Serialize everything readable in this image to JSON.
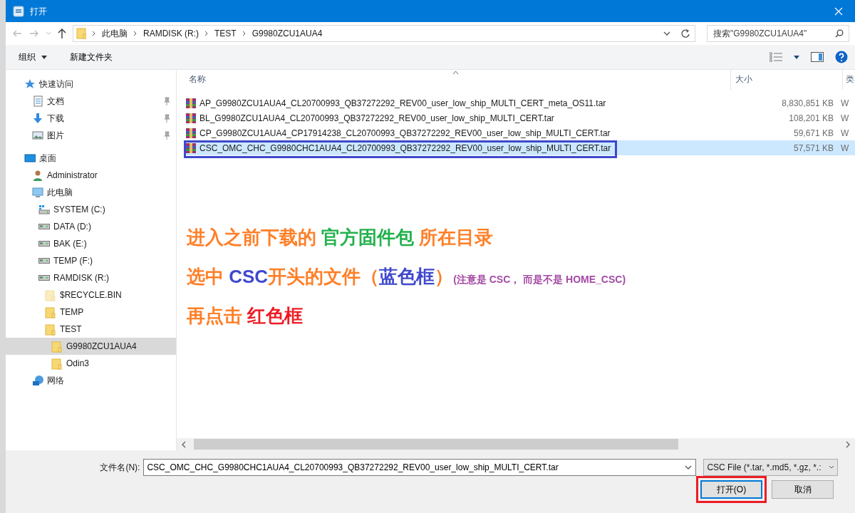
{
  "window": {
    "title": "打开"
  },
  "breadcrumb": [
    "此电脑",
    "RAMDISK (R:)",
    "TEST",
    "G9980ZCU1AUA4"
  ],
  "search": {
    "placeholder": "搜索\"G9980ZCU1AUA4\""
  },
  "toolbar": {
    "organize": "组织",
    "new_folder": "新建文件夹"
  },
  "sidebar": {
    "items": [
      {
        "label": "快速访问",
        "kind": "star",
        "selected": false,
        "children": [
          {
            "label": "文档",
            "kind": "document",
            "pinned": true,
            "selected": false
          },
          {
            "label": "下载",
            "kind": "download",
            "pinned": true,
            "selected": false
          },
          {
            "label": "图片",
            "kind": "picture",
            "pinned": true,
            "selected": false
          }
        ]
      },
      {
        "label": "桌面",
        "kind": "desktop",
        "selected": false,
        "children": [
          {
            "label": "Administrator",
            "kind": "user",
            "selected": false
          },
          {
            "label": "此电脑",
            "kind": "computer",
            "selected": false,
            "children": [
              {
                "label": "SYSTEM (C:)",
                "kind": "system-drive",
                "selected": false
              },
              {
                "label": "DATA (D:)",
                "kind": "drive",
                "selected": false
              },
              {
                "label": "BAK (E:)",
                "kind": "drive",
                "selected": false
              },
              {
                "label": "TEMP (F:)",
                "kind": "drive",
                "selected": false
              },
              {
                "label": "RAMDISK (R:)",
                "kind": "drive",
                "selected": false,
                "children": [
                  {
                    "label": "$RECYCLE.BIN",
                    "kind": "folder",
                    "hidden": true,
                    "selected": false
                  },
                  {
                    "label": "TEMP",
                    "kind": "folder",
                    "selected": false
                  },
                  {
                    "label": "TEST",
                    "kind": "folder",
                    "selected": false,
                    "children": [
                      {
                        "label": "G9980ZCU1AUA4",
                        "kind": "folder",
                        "selected": true
                      },
                      {
                        "label": "Odin3",
                        "kind": "folder",
                        "selected": false
                      }
                    ]
                  }
                ]
              }
            ]
          },
          {
            "label": "网络",
            "kind": "network",
            "selected": false
          }
        ]
      }
    ]
  },
  "table": {
    "columns": [
      "名称",
      "大小",
      "类"
    ],
    "rows": [
      {
        "name": "AP_G9980ZCU1AUA4_CL20700993_QB37272292_REV00_user_low_ship_MULTI_CERT_meta_OS11.tar",
        "size": "8,830,851 KB",
        "column_3": "W",
        "selected": false,
        "framed": false
      },
      {
        "name": "BL_G9980ZCU1AUA4_CL20700993_QB37272292_REV00_user_low_ship_MULTI_CERT.tar",
        "size": "108,201 KB",
        "column_3": "W",
        "selected": false,
        "framed": false
      },
      {
        "name": "CP_G9980ZCU1AUA4_CP17914238_CL20700993_QB37272292_REV00_user_low_ship_MULTI_CERT.tar",
        "size": "59,671 KB",
        "column_3": "W",
        "selected": false,
        "framed": false
      },
      {
        "name": "CSC_OMC_CHC_G9980CHC1AUA4_CL20700993_QB37272292_REV00_user_low_ship_MULTI_CERT.tar",
        "size": "57,571 KB",
        "column_3": "W",
        "selected": true,
        "framed": true
      }
    ]
  },
  "instructions": [
    {
      "segments": [
        {
          "text": "进入之前下载的 ",
          "color": "#ff7f27",
          "kind": "large"
        },
        {
          "text": "官方固件包",
          "color": "#22b14c",
          "kind": "large"
        },
        {
          "text": " 所在目录",
          "color": "#ff7f27",
          "kind": "large"
        }
      ]
    },
    {
      "segments": [
        {
          "text": "选中 ",
          "color": "#ff7f27",
          "kind": "large"
        },
        {
          "text": "CSC",
          "color": "#3f48cc",
          "kind": "large"
        },
        {
          "text": "开头的文件（",
          "color": "#ff7f27",
          "kind": "large"
        },
        {
          "text": "蓝色框",
          "color": "#3f48cc",
          "kind": "large"
        },
        {
          "text": "）",
          "color": "#ff7f27",
          "kind": "large"
        },
        {
          "text": "(注意是 CSC， 而是不是 HOME_CSC)",
          "color": "#a349a4",
          "kind": "small"
        }
      ]
    },
    {
      "segments": [
        {
          "text": "再点击 ",
          "color": "#ff7f27",
          "kind": "large"
        },
        {
          "text": "红色框",
          "color": "#ed1c24",
          "kind": "large"
        }
      ]
    }
  ],
  "filename": {
    "label": "文件名(N):",
    "value": "CSC_OMC_CHC_G9980CHC1AUA4_CL20700993_QB37272292_REV00_user_low_ship_MULTI_CERT.tar"
  },
  "filter": {
    "value": "CSC File (*.tar, *.md5, *.gz, *.:"
  },
  "buttons": [
    {
      "label": "打开(O)",
      "default": true,
      "framed": true
    },
    {
      "label": "取消",
      "default": false,
      "framed": false
    }
  ]
}
